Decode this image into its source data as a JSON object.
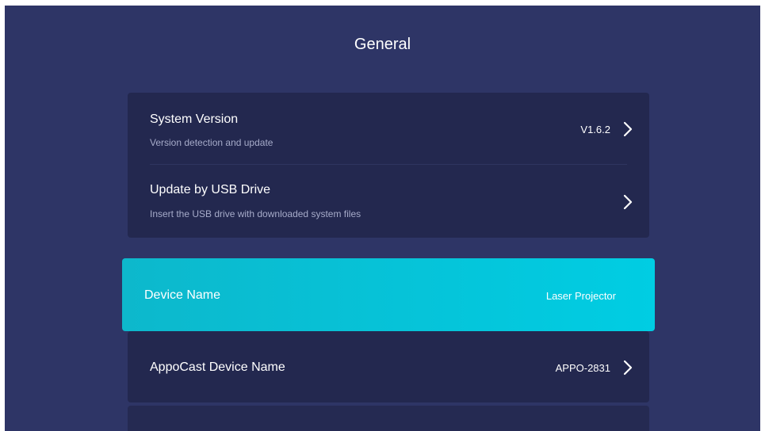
{
  "header": {
    "title": "General"
  },
  "settings": {
    "system_version": {
      "title": "System Version",
      "subtitle": "Version detection and update",
      "value": "V1.6.2",
      "chevron_icon": "chevron-right-icon"
    },
    "usb_update": {
      "title": "Update by USB Drive",
      "subtitle": "Insert the USB drive with downloaded system files",
      "chevron_icon": "chevron-right-icon"
    },
    "device_name": {
      "title": "Device Name",
      "value": "Laser Projector",
      "focused": true
    },
    "appocast_name": {
      "title": "AppoCast Device Name",
      "value": "APPO-2831",
      "chevron_icon": "chevron-right-icon"
    }
  },
  "colors": {
    "background": "#2e3566",
    "card": "#23284f",
    "highlight": "#00cde3",
    "text_primary": "#ffffff",
    "text_secondary": "#a6abc9"
  }
}
